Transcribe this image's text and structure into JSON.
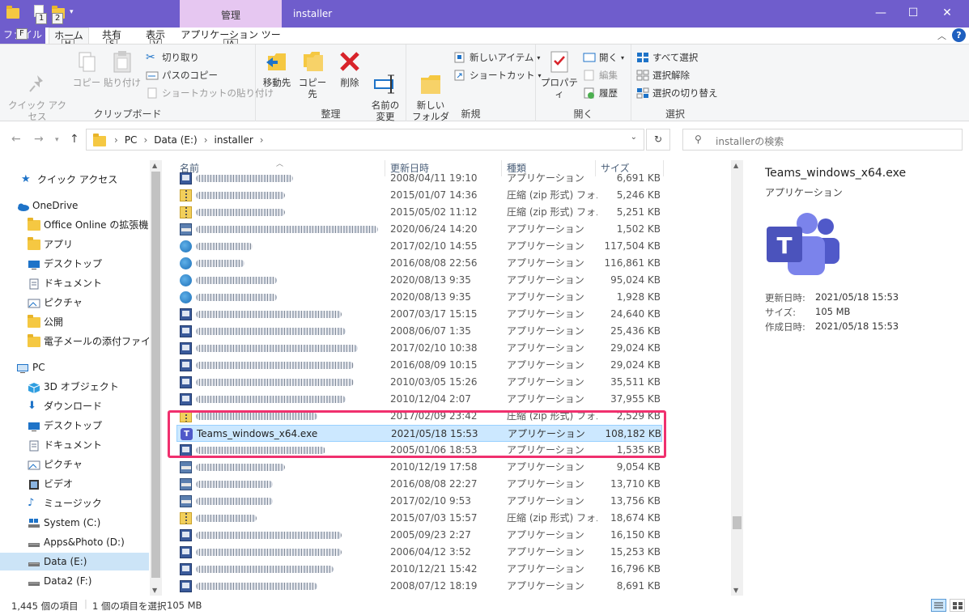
{
  "titlebar": {
    "context_tab": "管理",
    "window_title": "installer",
    "keytips": [
      "1",
      "2"
    ]
  },
  "tabs": {
    "file": "ファイル",
    "file_keytip": "F",
    "home": "ホーム",
    "home_keytip": "H",
    "share": "共有",
    "share_keytip": "S",
    "view": "表示",
    "view_keytip": "V",
    "app_tools": "アプリケーション ツール",
    "app_tools_keytip": "JA"
  },
  "ribbon": {
    "clipboard": {
      "label": "クリップボード",
      "pin": "クイック アクセス\nにピン留めする",
      "copy": "コピー",
      "paste": "貼り付け",
      "cut": "切り取り",
      "copy_path": "パスのコピー",
      "paste_shortcut": "ショートカットの貼り付け"
    },
    "organize": {
      "label": "整理",
      "move_to": "移動先",
      "copy_to": "コピー先",
      "delete": "削除",
      "rename": "名前の\n変更"
    },
    "new": {
      "label": "新規",
      "new_folder": "新しい\nフォルダー",
      "new_item": "新しいアイテム",
      "shortcut": "ショートカット"
    },
    "open": {
      "label": "開く",
      "properties": "プロパティ",
      "open": "開く",
      "edit": "編集",
      "history": "履歴"
    },
    "select": {
      "label": "選択",
      "select_all": "すべて選択",
      "select_none": "選択解除",
      "invert": "選択の切り替え"
    }
  },
  "address": {
    "crumbs": [
      "PC",
      "Data (E:)",
      "installer"
    ],
    "search_placeholder": "installerの検索"
  },
  "nav": {
    "items": [
      {
        "label": "クイック アクセス",
        "icon": "star-icon",
        "selected": false
      },
      {
        "label": "OneDrive",
        "icon": "cloud-icon",
        "selected": false
      },
      {
        "label": "Office Online の拡張機能",
        "icon": "folder-icon",
        "selected": false
      },
      {
        "label": "アプリ",
        "icon": "folder-icon",
        "selected": false
      },
      {
        "label": "デスクトップ",
        "icon": "desktop-icon",
        "selected": false
      },
      {
        "label": "ドキュメント",
        "icon": "document-icon",
        "selected": false
      },
      {
        "label": "ピクチャ",
        "icon": "pictures-icon",
        "selected": false
      },
      {
        "label": "公開",
        "icon": "folder-icon",
        "selected": false
      },
      {
        "label": "電子メールの添付ファイル",
        "icon": "folder-icon",
        "selected": false
      },
      {
        "label": "PC",
        "icon": "pc-icon",
        "selected": false
      },
      {
        "label": "3D オブジェクト",
        "icon": "cube-icon",
        "selected": false
      },
      {
        "label": "ダウンロード",
        "icon": "download-icon",
        "selected": false
      },
      {
        "label": "デスクトップ",
        "icon": "desktop-icon",
        "selected": false
      },
      {
        "label": "ドキュメント",
        "icon": "document-icon",
        "selected": false
      },
      {
        "label": "ピクチャ",
        "icon": "pictures-icon",
        "selected": false
      },
      {
        "label": "ビデオ",
        "icon": "video-icon",
        "selected": false
      },
      {
        "label": "ミュージック",
        "icon": "music-icon",
        "selected": false
      },
      {
        "label": "System (C:)",
        "icon": "system-drive-icon",
        "selected": false
      },
      {
        "label": "Apps&Photo (D:)",
        "icon": "drive-icon",
        "selected": false
      },
      {
        "label": "Data (E:)",
        "icon": "drive-icon",
        "selected": true
      },
      {
        "label": "Data2 (F:)",
        "icon": "drive-icon",
        "selected": false
      }
    ]
  },
  "files": {
    "columns": {
      "name": "名前",
      "date": "更新日時",
      "type": "種類",
      "size": "サイズ"
    },
    "rows": [
      {
        "name": "",
        "date": "2008/04/11 19:10",
        "type": "アプリケーション",
        "size": "6,691 KB",
        "icon": "exe",
        "blur": 120
      },
      {
        "name": "",
        "date": "2015/01/07 14:36",
        "type": "圧縮 (zip 形式) フォルダー",
        "size": "5,246 KB",
        "icon": "zip",
        "blur": 110
      },
      {
        "name": "",
        "date": "2015/05/02 11:12",
        "type": "圧縮 (zip 形式) フォルダー",
        "size": "5,251 KB",
        "icon": "zip",
        "blur": 110
      },
      {
        "name": "",
        "date": "2020/06/24 14:20",
        "type": "アプリケーション",
        "size": "1,502 KB",
        "icon": "setup",
        "blur": 225
      },
      {
        "name": "",
        "date": "2017/02/10 14:55",
        "type": "アプリケーション",
        "size": "117,504 KB",
        "icon": "globe",
        "blur": 70
      },
      {
        "name": "",
        "date": "2016/08/08 22:56",
        "type": "アプリケーション",
        "size": "116,861 KB",
        "icon": "globe",
        "blur": 60
      },
      {
        "name": "",
        "date": "2020/08/13 9:35",
        "type": "アプリケーション",
        "size": "95,024 KB",
        "icon": "globe",
        "blur": 100
      },
      {
        "name": "",
        "date": "2020/08/13 9:35",
        "type": "アプリケーション",
        "size": "1,928 KB",
        "icon": "globe",
        "blur": 100
      },
      {
        "name": "",
        "date": "2007/03/17 15:15",
        "type": "アプリケーション",
        "size": "24,640 KB",
        "icon": "exe",
        "blur": 180
      },
      {
        "name": "",
        "date": "2008/06/07 1:35",
        "type": "アプリケーション",
        "size": "25,436 KB",
        "icon": "exe",
        "blur": 185
      },
      {
        "name": "",
        "date": "2017/02/10 10:38",
        "type": "アプリケーション",
        "size": "29,024 KB",
        "icon": "exe",
        "blur": 200
      },
      {
        "name": "",
        "date": "2016/08/09 10:15",
        "type": "アプリケーション",
        "size": "29,024 KB",
        "icon": "exe",
        "blur": 195
      },
      {
        "name": "",
        "date": "2010/03/05 15:26",
        "type": "アプリケーション",
        "size": "35,511 KB",
        "icon": "exe",
        "blur": 195
      },
      {
        "name": "",
        "date": "2010/12/04 2:07",
        "type": "アプリケーション",
        "size": "37,955 KB",
        "icon": "exe",
        "blur": 185
      },
      {
        "name": "",
        "date": "2017/02/09 23:42",
        "type": "圧縮 (zip 形式) フォルダー",
        "size": "2,529 KB",
        "icon": "zip",
        "blur": 150
      },
      {
        "name": "Teams_windows_x64.exe",
        "date": "2021/05/18 15:53",
        "type": "アプリケーション",
        "size": "108,182 KB",
        "icon": "teams",
        "blur": 0,
        "selected": true
      },
      {
        "name": "",
        "date": "2005/01/06 18:53",
        "type": "アプリケーション",
        "size": "1,535 KB",
        "icon": "exe",
        "blur": 160
      },
      {
        "name": "",
        "date": "2010/12/19 17:58",
        "type": "アプリケーション",
        "size": "9,054 KB",
        "icon": "setup",
        "blur": 110
      },
      {
        "name": "",
        "date": "2016/08/08 22:27",
        "type": "アプリケーション",
        "size": "13,710 KB",
        "icon": "setup",
        "blur": 95
      },
      {
        "name": "",
        "date": "2017/02/10 9:53",
        "type": "アプリケーション",
        "size": "13,756 KB",
        "icon": "setup",
        "blur": 95
      },
      {
        "name": "",
        "date": "2015/07/03 15:57",
        "type": "圧縮 (zip 形式) フォルダー",
        "size": "18,674 KB",
        "icon": "zip",
        "blur": 75
      },
      {
        "name": "",
        "date": "2005/09/23 2:27",
        "type": "アプリケーション",
        "size": "16,150 KB",
        "icon": "exe",
        "blur": 180
      },
      {
        "name": "",
        "date": "2006/04/12 3:52",
        "type": "アプリケーション",
        "size": "15,253 KB",
        "icon": "exe",
        "blur": 180
      },
      {
        "name": "",
        "date": "2010/12/21 15:42",
        "type": "アプリケーション",
        "size": "16,796 KB",
        "icon": "exe",
        "blur": 170
      },
      {
        "name": "",
        "date": "2008/07/12 18:19",
        "type": "アプリケーション",
        "size": "8,691 KB",
        "icon": "exe",
        "blur": 150
      }
    ]
  },
  "preview": {
    "name": "Teams_windows_x64.exe",
    "type": "アプリケーション",
    "modified_label": "更新日時:",
    "modified_value": "2021/05/18 15:53",
    "size_label": "サイズ:",
    "size_value": "105 MB",
    "created_label": "作成日時:",
    "created_value": "2021/05/18 15:53"
  },
  "status": {
    "count": "1,445 個の項目",
    "selected": "1 個の項目を選択",
    "size": "105 MB"
  },
  "colors": {
    "titlebar": "#6f5dcc",
    "context_tab": "#e6c7f1",
    "selection": "#cce8ff",
    "highlight": "#f0306e",
    "teams": "#5059c9"
  }
}
